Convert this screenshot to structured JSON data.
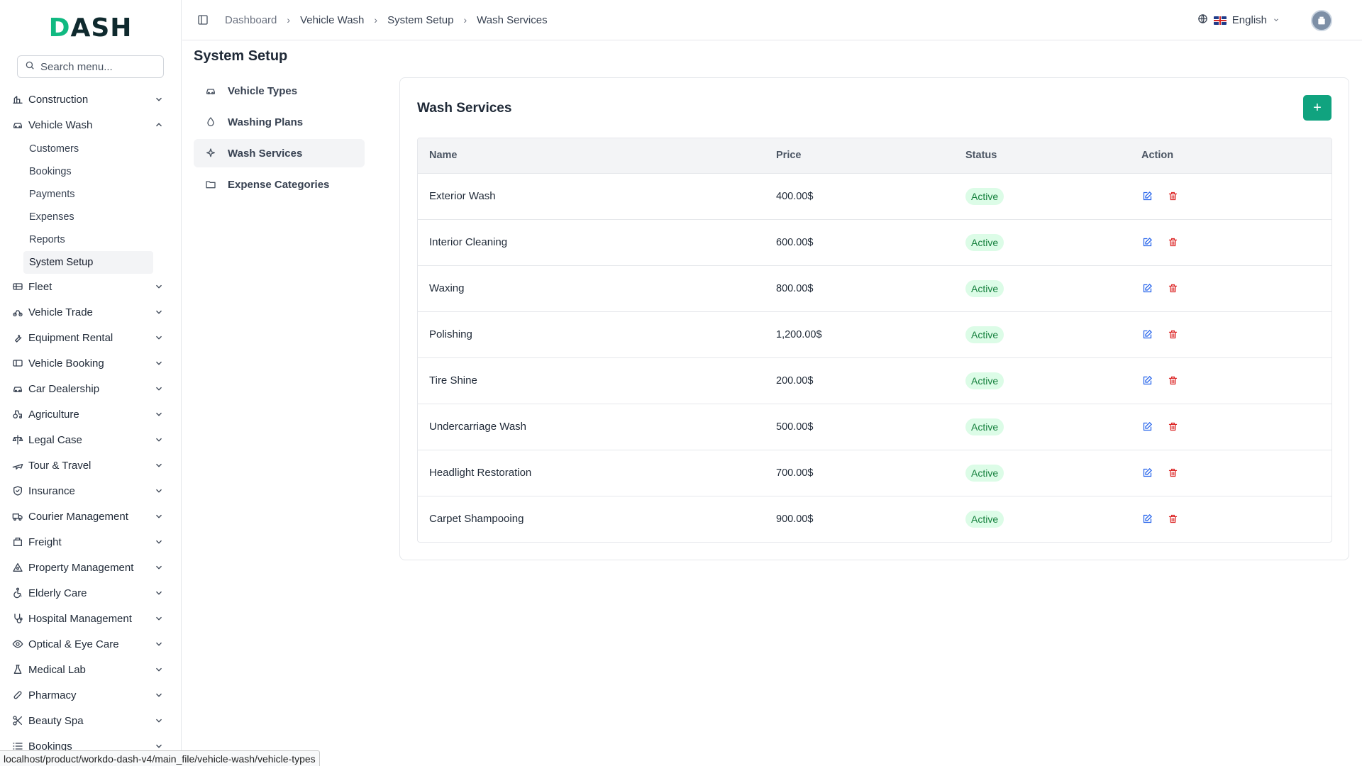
{
  "sidebar": {
    "search_placeholder": "Search menu...",
    "items": [
      {
        "label": "Construction",
        "icon": "construction-icon"
      },
      {
        "label": "Vehicle Wash",
        "icon": "vehicle-wash-icon",
        "expanded": true
      },
      {
        "label": "Fleet",
        "icon": "fleet-icon"
      },
      {
        "label": "Vehicle Trade",
        "icon": "vehicle-trade-icon"
      },
      {
        "label": "Equipment Rental",
        "icon": "wrench-icon"
      },
      {
        "label": "Vehicle Booking",
        "icon": "ticket-icon"
      },
      {
        "label": "Car Dealership",
        "icon": "car-icon"
      },
      {
        "label": "Agriculture",
        "icon": "tractor-icon"
      },
      {
        "label": "Legal Case",
        "icon": "scale-icon"
      },
      {
        "label": "Tour & Travel",
        "icon": "plane-icon"
      },
      {
        "label": "Insurance",
        "icon": "shield-icon"
      },
      {
        "label": "Courier Management",
        "icon": "truck-icon"
      },
      {
        "label": "Freight",
        "icon": "freight-icon"
      },
      {
        "label": "Property Management",
        "icon": "property-icon"
      },
      {
        "label": "Elderly Care",
        "icon": "accessibility-icon"
      },
      {
        "label": "Hospital Management",
        "icon": "stethoscope-icon"
      },
      {
        "label": "Optical & Eye Care",
        "icon": "eye-icon"
      },
      {
        "label": "Medical Lab",
        "icon": "flask-icon"
      },
      {
        "label": "Pharmacy",
        "icon": "pill-icon"
      },
      {
        "label": "Beauty Spa",
        "icon": "scissors-icon"
      },
      {
        "label": "Bookings",
        "icon": "list-icon"
      }
    ],
    "vehicle_wash_sub": [
      "Customers",
      "Bookings",
      "Payments",
      "Expenses",
      "Reports",
      "System Setup"
    ],
    "active_sub": "System Setup"
  },
  "header": {
    "breadcrumb": [
      "Dashboard",
      "Vehicle Wash",
      "System Setup",
      "Wash Services"
    ],
    "language": "English"
  },
  "page": {
    "title": "System Setup",
    "setup_nav": [
      {
        "label": "Vehicle Types",
        "icon": "car-icon"
      },
      {
        "label": "Washing Plans",
        "icon": "droplet-icon"
      },
      {
        "label": "Wash Services",
        "icon": "sparkles-icon",
        "active": true
      },
      {
        "label": "Expense Categories",
        "icon": "folder-icon"
      }
    ]
  },
  "card": {
    "title": "Wash Services",
    "add_label": "+",
    "columns": [
      "Name",
      "Price",
      "Status",
      "Action"
    ],
    "rows": [
      {
        "name": "Exterior Wash",
        "price": "400.00$",
        "status": "Active"
      },
      {
        "name": "Interior Cleaning",
        "price": "600.00$",
        "status": "Active"
      },
      {
        "name": "Waxing",
        "price": "800.00$",
        "status": "Active"
      },
      {
        "name": "Polishing",
        "price": "1,200.00$",
        "status": "Active"
      },
      {
        "name": "Tire Shine",
        "price": "200.00$",
        "status": "Active"
      },
      {
        "name": "Undercarriage Wash",
        "price": "500.00$",
        "status": "Active"
      },
      {
        "name": "Headlight Restoration",
        "price": "700.00$",
        "status": "Active"
      },
      {
        "name": "Carpet Shampooing",
        "price": "900.00$",
        "status": "Active"
      }
    ]
  },
  "status_url": "localhost/product/workdo-dash-v4/main_file/vehicle-wash/vehicle-types",
  "colors": {
    "accent": "#10a37f",
    "badge_bg": "#dcfce7",
    "badge_text": "#15803d",
    "edit": "#2563eb",
    "delete": "#dc2626"
  }
}
